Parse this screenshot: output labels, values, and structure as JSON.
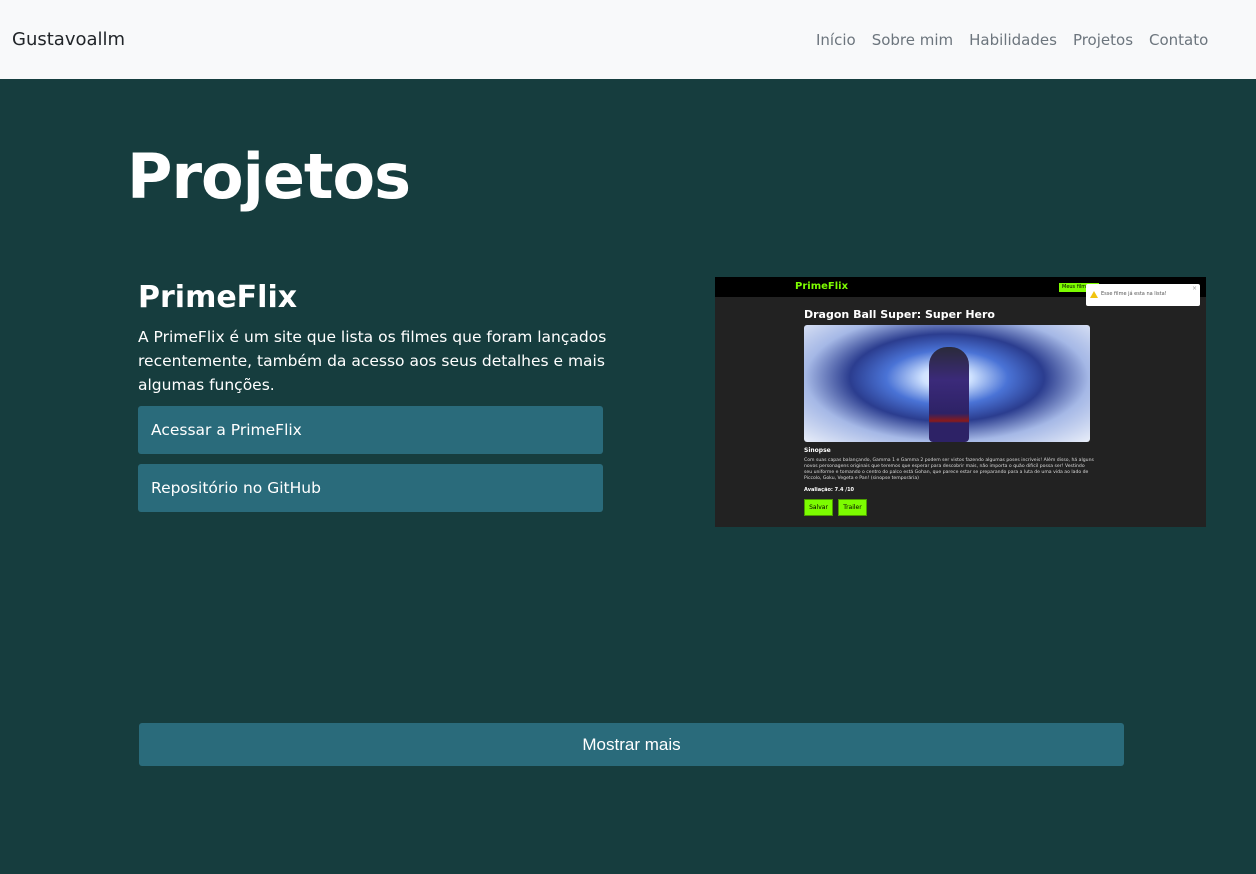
{
  "navbar": {
    "brand": "Gustavoallm",
    "links": [
      "Início",
      "Sobre mim",
      "Habilidades",
      "Projetos",
      "Contato"
    ]
  },
  "section": {
    "title": "Projetos"
  },
  "project": {
    "name": "PrimeFlix",
    "description": "A PrimeFlix é um site que lista os filmes que foram lançados recentemente, também da acesso aos seus detalhes e mais algumas funções.",
    "access_button": "Acessar a PrimeFlix",
    "repo_button": "Repositório no GitHub",
    "preview": {
      "logo": "PrimeFlix",
      "my_list": "Meus filmes",
      "toast": "Esse filme já esta na lista!",
      "toast_close": "×",
      "movie_title": "Dragon Ball Super: Super Hero",
      "sinopse_label": "Sinopse",
      "sinopse_text": "Com suas capas balançando, Gamma 1 e Gamma 2 podem ser vistos fazendo algumas poses incríveis! Além disso, há alguns novos personagens originais que teremos que esperar para descobrir mais, não importa o quão difícil possa ser! Vestindo seu uniforme e tomando o centro do palco está Gohan, que parece estar se preparando para a luta de uma vida ao lado de Piccolo, Goku, Vegeta e Pan! (sinopse temporária)",
      "rating": "Avaliação: 7.4 /10",
      "save_button": "Salvar",
      "trailer_button": "Trailer"
    }
  },
  "show_more": "Mostrar mais"
}
